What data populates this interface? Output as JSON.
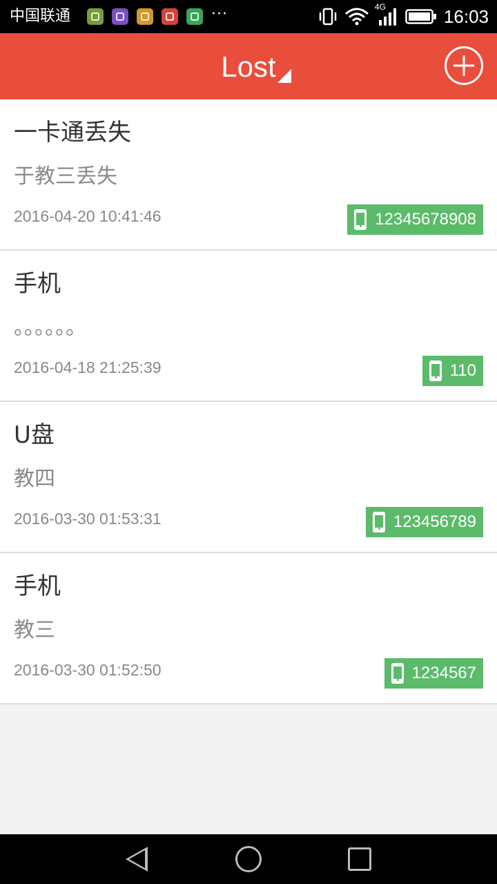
{
  "status_bar": {
    "carrier": "中国联通",
    "more": "···",
    "network": "4G",
    "time": "16:03",
    "app_icon_colors": [
      "#7a9b3c",
      "#7b4fc4",
      "#d4952b",
      "#d4433a",
      "#3aa35a"
    ]
  },
  "app_bar": {
    "title": "Lost",
    "add_icon": "plus-circle-icon",
    "background": "#e94e3c"
  },
  "items": [
    {
      "title": "一卡通丢失",
      "description": "于教三丢失",
      "time": "2016-04-20 10:41:46",
      "phone": "12345678908"
    },
    {
      "title": "手机",
      "description": "。。。。。。",
      "time": "2016-04-18 21:25:39",
      "phone": "110"
    },
    {
      "title": "U盘",
      "description": "教四",
      "time": "2016-03-30 01:53:31",
      "phone": "123456789"
    },
    {
      "title": "手机",
      "description": "教三",
      "time": "2016-03-30 01:52:50",
      "phone": "1234567"
    }
  ],
  "colors": {
    "phone_badge": "#5cbb6a"
  },
  "nav_bar": {
    "back_icon": "back-triangle-icon",
    "home_icon": "home-circle-icon",
    "recent_icon": "recent-square-icon"
  }
}
